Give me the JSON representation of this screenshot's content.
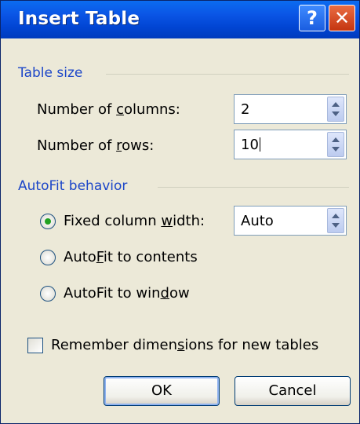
{
  "window": {
    "title": "Insert Table"
  },
  "titlebar_buttons": {
    "help_glyph": "?",
    "close_glyph": "✕"
  },
  "table_size": {
    "group_label": "Table size",
    "columns_label_pre": "Number of ",
    "columns_label_key": "c",
    "columns_label_post": "olumns:",
    "columns_value": "2",
    "rows_label_pre": "Number of ",
    "rows_label_key": "r",
    "rows_label_post": "ows:",
    "rows_value": "10"
  },
  "autofit": {
    "group_label": "AutoFit behavior",
    "fixed_pre": "Fixed column ",
    "fixed_key": "w",
    "fixed_post": "idth:",
    "fixed_value": "Auto",
    "contents_pre": "Auto",
    "contents_key": "F",
    "contents_post": "it to contents",
    "window_pre": "AutoFit to win",
    "window_key": "d",
    "window_post": "ow",
    "selected": "fixed"
  },
  "remember": {
    "pre": "Remember dimen",
    "key": "s",
    "post": "ions for new tables",
    "checked": false
  },
  "buttons": {
    "ok": "OK",
    "cancel": "Cancel"
  },
  "colors": {
    "titlebar": "#0145d3",
    "group_label": "#1c46c8",
    "radio_selected": "#21a121"
  }
}
